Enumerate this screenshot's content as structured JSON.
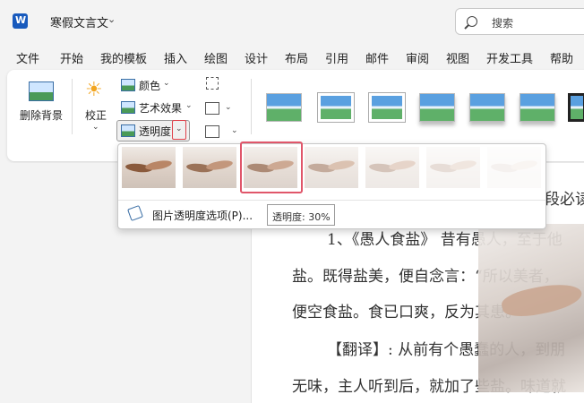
{
  "app": {
    "title": "寒假文言文",
    "search_placeholder": "搜索"
  },
  "menu": [
    "文件",
    "开始",
    "我的模板",
    "插入",
    "绘图",
    "设计",
    "布局",
    "引用",
    "邮件",
    "审阅",
    "视图",
    "开发工具",
    "帮助"
  ],
  "ribbon": {
    "remove_bg": "删除背景",
    "corrections": "校正",
    "color": "颜色",
    "artistic_effects": "艺术效果",
    "transparency": "透明度"
  },
  "transparency_menu": {
    "options_link": "图片透明度选项(P)...",
    "selected_index": 2,
    "tooltip": "透明度: 30%"
  },
  "document": {
    "line1_fragment": "段必读",
    "line2": "1、《愚人食盐》 昔有愚人，至于他",
    "line3": "盐。既得盐美，便自念言：“所以美者，",
    "line4": "便空食盐。食已口爽，反为其患。",
    "line5": "【翻译】: 从前有个愚蠢的人，到朋",
    "line6": "无味，主人听到后，就加了些盐。味道就"
  },
  "colors": {
    "accent_red": "#e0404a",
    "word_blue": "#185abd"
  }
}
